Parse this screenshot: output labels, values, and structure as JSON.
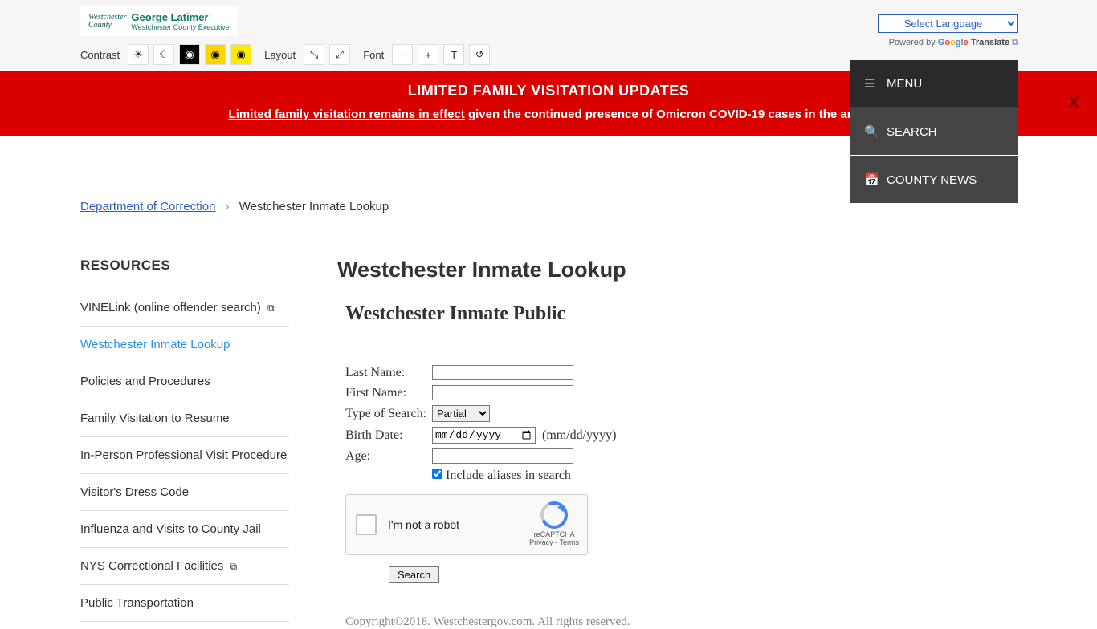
{
  "header": {
    "logo_line1": "Westchester",
    "logo_line2": "County",
    "logo_name": "George Latimer",
    "logo_title": "Westchester County Executive"
  },
  "tools": {
    "contrast_label": "Contrast",
    "layout_label": "Layout",
    "font_label": "Font"
  },
  "language": {
    "selected": "Select Language",
    "powered": "Powered by",
    "translate": "Translate"
  },
  "banner": {
    "title": "LIMITED FAMILY VISITATION UPDATES",
    "link_text": "Limited family visitation remains in effect",
    "rest_text": " given the continued presence of Omicron COVID-19 cases in the area.",
    "close": "X"
  },
  "sidenav": {
    "menu": "MENU",
    "search": "SEARCH",
    "news": "COUNTY NEWS"
  },
  "breadcrumb": {
    "root": "Department of Correction",
    "current": "Westchester Inmate Lookup"
  },
  "sidebar": {
    "heading": "RESOURCES",
    "items": [
      "VINELink (online offender search)",
      "Westchester Inmate Lookup",
      "Policies and Procedures",
      "Family Visitation to Resume",
      "In-Person Professional Visit Procedure",
      "Visitor's Dress Code",
      "Influenza and Visits to County Jail",
      "NYS Correctional Facilities",
      "Public Transportation"
    ]
  },
  "main": {
    "title": "Westchester Inmate Lookup",
    "subtitle": "Westchester Inmate Public",
    "form": {
      "last_name": "Last Name:",
      "first_name": "First Name:",
      "search_type": "Type of Search:",
      "search_type_value": "Partial",
      "birth_date": "Birth Date:",
      "birth_placeholder": "mm/dd/yyyy",
      "birth_hint": "(mm/dd/yyyy)",
      "age": "Age:",
      "aliases": "Include aliases in search",
      "recaptcha_text": "I'm not a robot",
      "recaptcha_brand": "reCAPTCHA",
      "recaptcha_links": "Privacy - Terms",
      "search_button": "Search"
    },
    "footer": "Copyright©2018. Westchestergov.com. All rights reserved."
  }
}
